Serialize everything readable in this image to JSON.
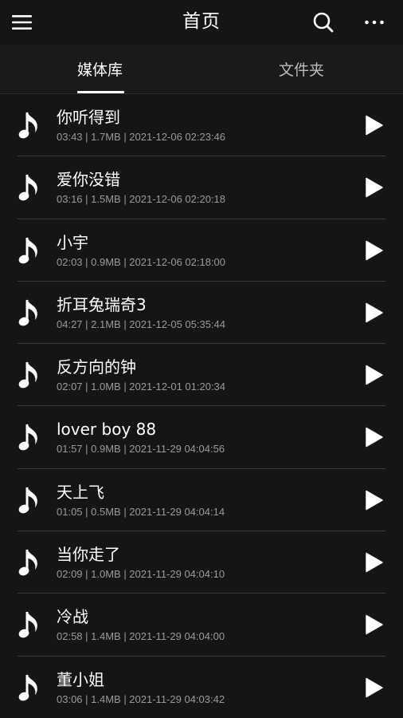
{
  "header": {
    "title": "首页",
    "menu_icon": "hamburger-menu-icon",
    "search_icon": "search-icon",
    "more_icon": "more-dots-icon"
  },
  "tabs": [
    {
      "label": "媒体库",
      "active": true
    },
    {
      "label": "文件夹",
      "active": false
    }
  ],
  "songs": [
    {
      "title": "你听得到",
      "meta": "03:43 | 1.7MB | 2021-12-06 02:23:46"
    },
    {
      "title": "爱你没错",
      "meta": "03:16 | 1.5MB | 2021-12-06 02:20:18"
    },
    {
      "title": "小宇",
      "meta": "02:03 | 0.9MB | 2021-12-06 02:18:00"
    },
    {
      "title": "折耳兔瑞奇3",
      "meta": "04:27 | 2.1MB | 2021-12-05 05:35:44"
    },
    {
      "title": "反方向的钟",
      "meta": "02:07 | 1.0MB | 2021-12-01 01:20:34"
    },
    {
      "title": "lover boy 88",
      "meta": "01:57 | 0.9MB | 2021-11-29 04:04:56"
    },
    {
      "title": "天上飞",
      "meta": "01:05 | 0.5MB | 2021-11-29 04:04:14"
    },
    {
      "title": "当你走了",
      "meta": "02:09 | 1.0MB | 2021-11-29 04:04:10"
    },
    {
      "title": "冷战",
      "meta": "02:58 | 1.4MB | 2021-11-29 04:04:00"
    },
    {
      "title": "董小姐",
      "meta": "03:06 | 1.4MB | 2021-11-29 04:03:42"
    }
  ],
  "colors": {
    "background": "#151515",
    "tab_bar": "#1a1a1a",
    "text_primary": "#ffffff",
    "text_secondary": "#9a9a9a",
    "divider": "#3a3a3a"
  }
}
